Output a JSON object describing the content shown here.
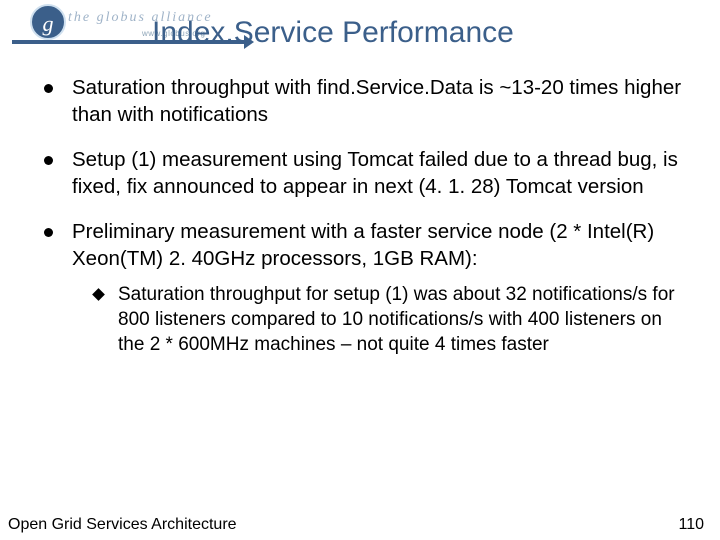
{
  "logo": {
    "g": "g",
    "brand": "the globus alliance",
    "url": "www.globus.org"
  },
  "title": "Index.Service Performance",
  "bullets": {
    "b1": "Saturation throughput with find.Service.Data is ~13-20 times higher than with notifications",
    "b2": "Setup (1) measurement using Tomcat failed due to a thread bug, is fixed, fix announced to appear in next (4. 1. 28) Tomcat version",
    "b3": "Preliminary measurement with a faster service node (2 * Intel(R) Xeon(TM) 2. 40GHz processors, 1GB RAM):",
    "b3_1": "Saturation throughput for setup (1) was about 32 notifications/s for 800 listeners compared to 10 notifications/s with 400 listeners on the 2 * 600MHz machines – not quite 4 times faster"
  },
  "footer": {
    "left": "Open Grid Services Architecture",
    "right": "110"
  }
}
